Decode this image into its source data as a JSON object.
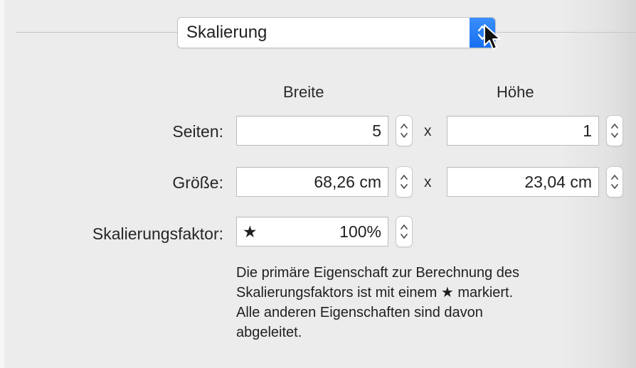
{
  "popup": {
    "label": "Skalierung",
    "icon": "chevron-updown-icon",
    "accent": "#1f7af5"
  },
  "columns": {
    "width": "Breite",
    "height": "Höhe"
  },
  "rows": {
    "pages": {
      "label": "Seiten:",
      "width_value": "5",
      "height_value": "1"
    },
    "size": {
      "label": "Größe:",
      "width_value": "68,26 cm",
      "height_value": "23,04 cm"
    },
    "scale": {
      "label": "Skalierungsfaktor:",
      "value": "100%",
      "marker": "★"
    }
  },
  "separator": "x",
  "note": {
    "line1": "Die primäre Eigenschaft zur Berechnung des",
    "line2a": "Skalierungsfaktors ist mit einem",
    "star": "★",
    "line2b": "markiert.",
    "line3": "Alle anderen Eigenschaften sind davon",
    "line4": "abgeleitet."
  }
}
